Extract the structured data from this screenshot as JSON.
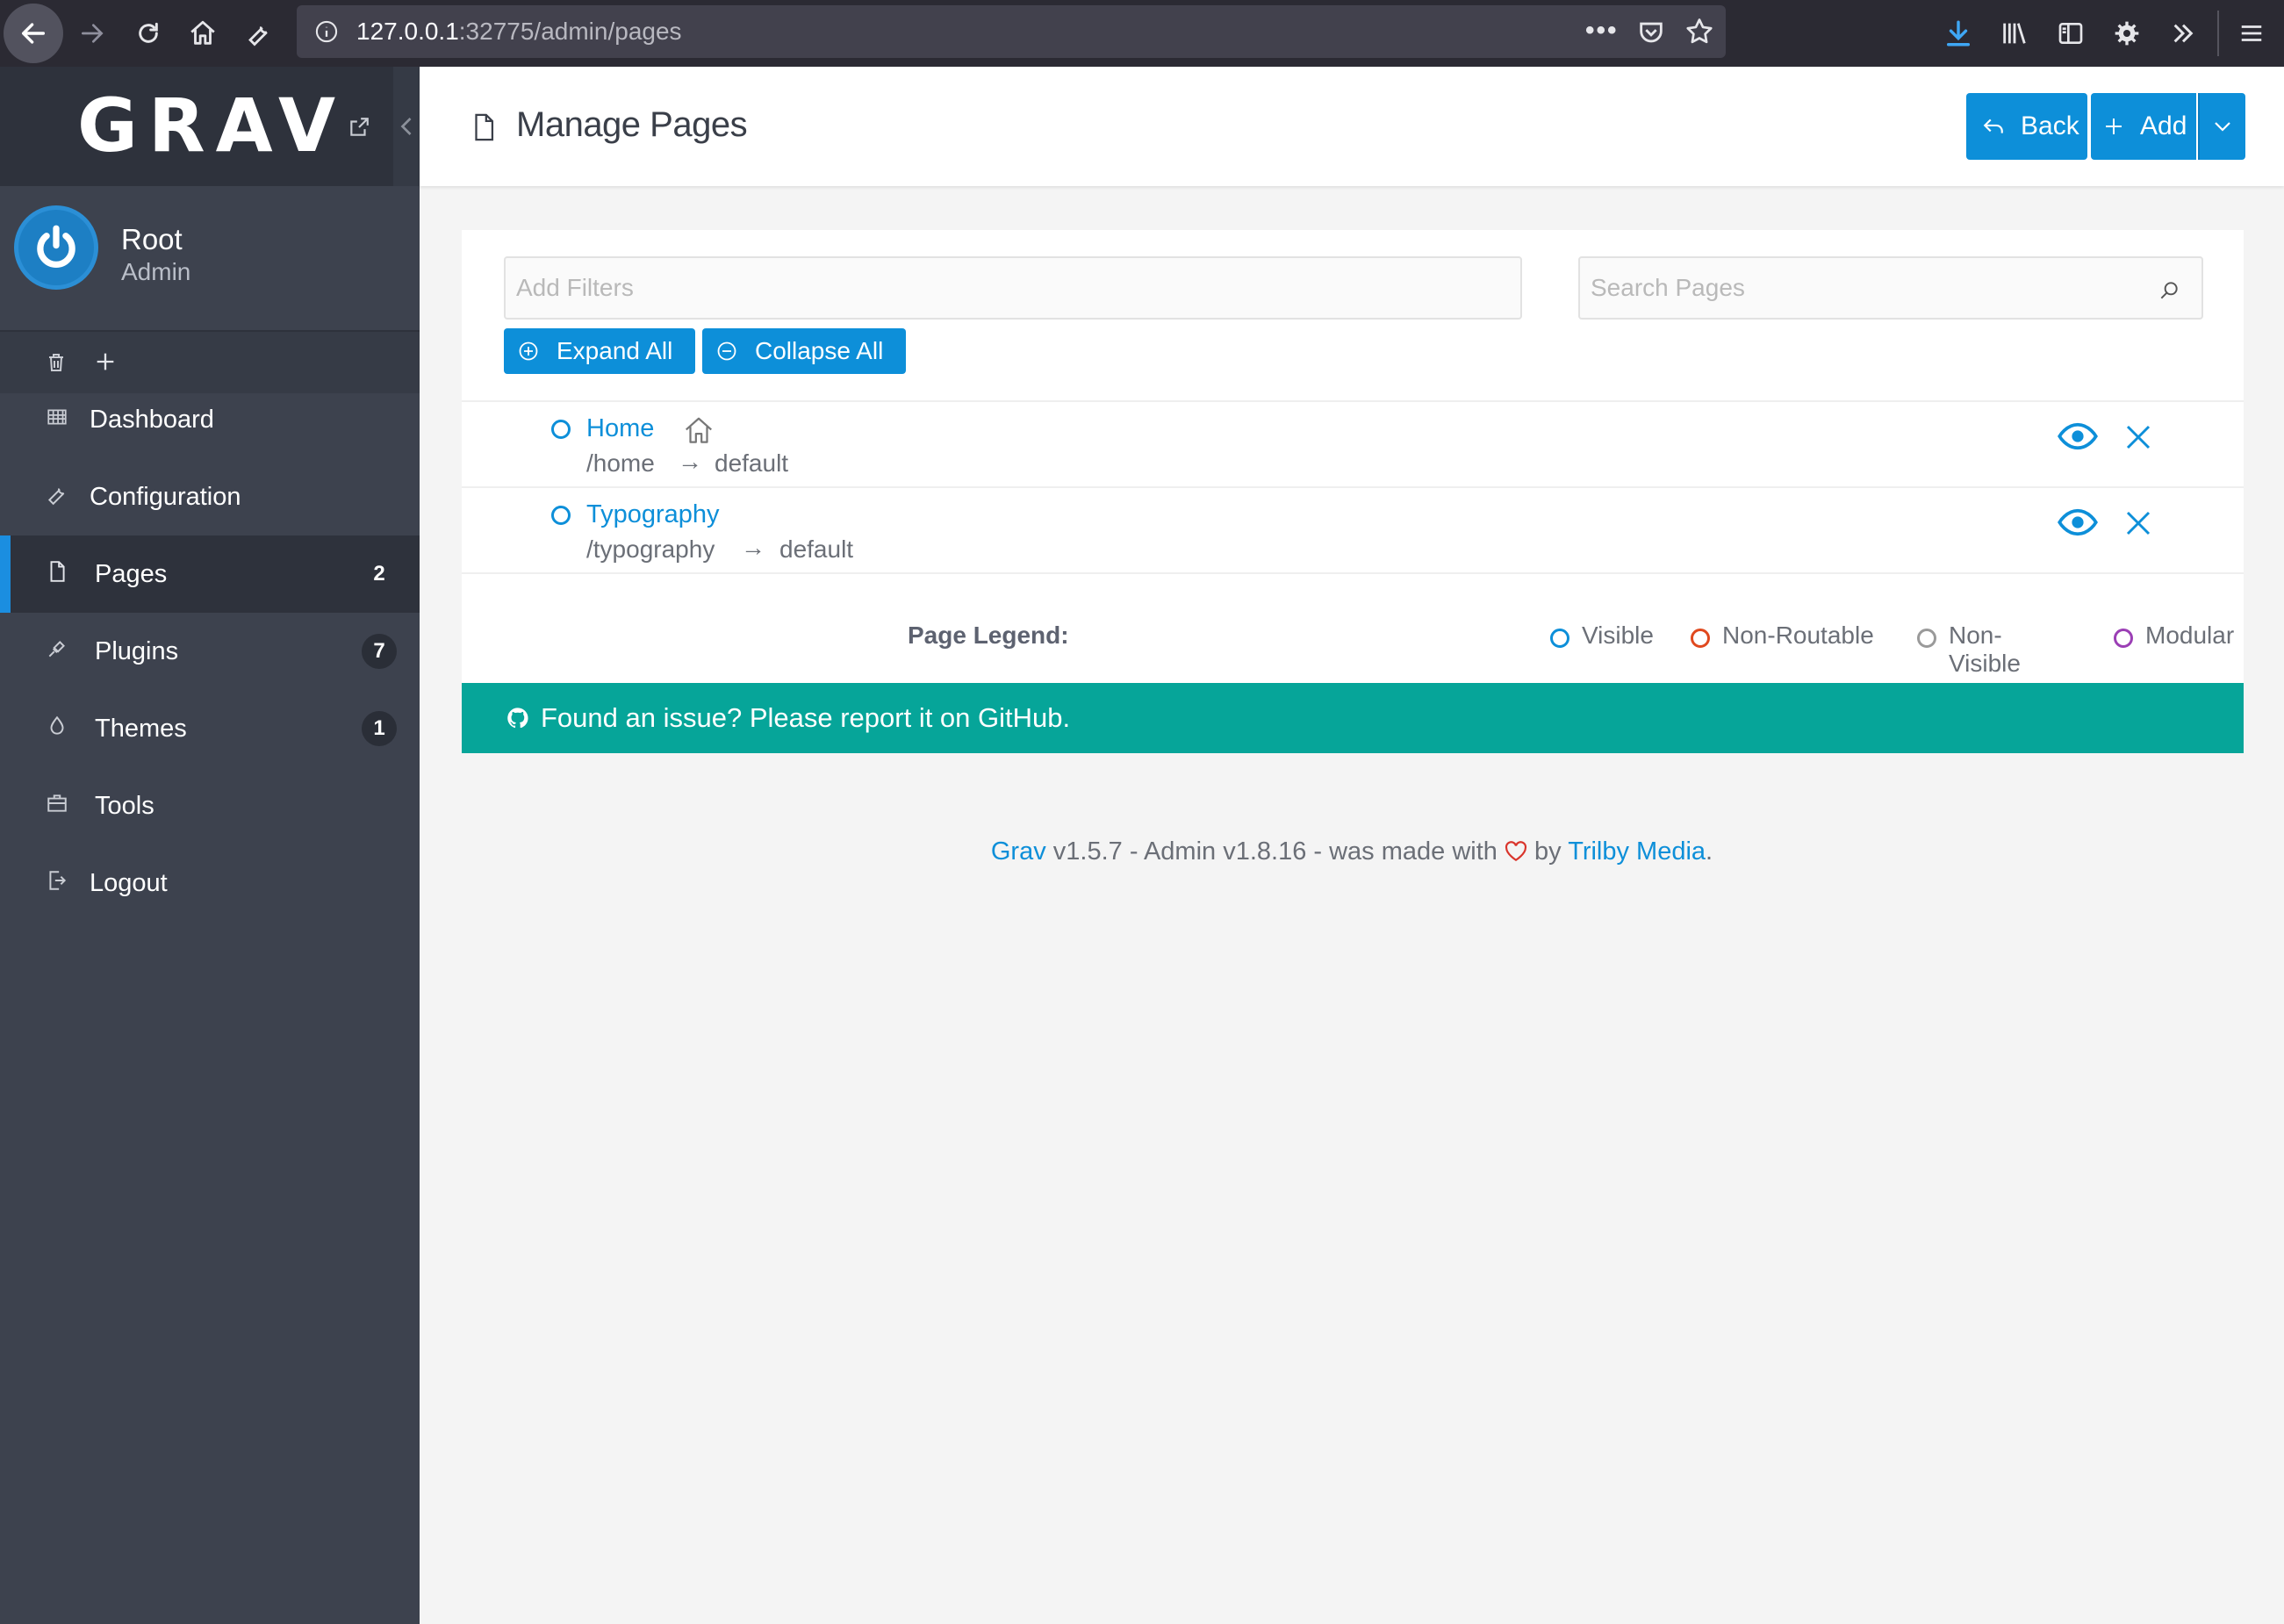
{
  "browser": {
    "url_host": "127.0.0.1",
    "url_rest": ":32775/admin/pages"
  },
  "sidebar": {
    "logo": "GRAV",
    "user": {
      "name": "Root",
      "role": "Admin"
    },
    "items": [
      {
        "label": "Dashboard",
        "icon": "dashboard-icon"
      },
      {
        "label": "Configuration",
        "icon": "wrench-icon"
      },
      {
        "label": "Pages",
        "icon": "file-icon",
        "badge": "2",
        "active": true
      },
      {
        "label": "Plugins",
        "icon": "plug-icon",
        "badge": "7"
      },
      {
        "label": "Themes",
        "icon": "droplet-icon",
        "badge": "1"
      },
      {
        "label": "Tools",
        "icon": "briefcase-icon"
      },
      {
        "label": "Logout",
        "icon": "logout-icon"
      }
    ]
  },
  "header": {
    "title": "Manage Pages",
    "back_label": "Back",
    "add_label": "Add"
  },
  "filters": {
    "filter_placeholder": "Add Filters",
    "search_placeholder": "Search Pages",
    "expand_label": "Expand All",
    "collapse_label": "Collapse All"
  },
  "pages": [
    {
      "title": "Home",
      "route": "/home",
      "template": "default",
      "is_home": true
    },
    {
      "title": "Typography",
      "route": "/typography",
      "template": "default"
    }
  ],
  "legend": {
    "title": "Page Legend:",
    "items": [
      {
        "label": "Visible",
        "color": "#0d8fd9"
      },
      {
        "label": "Non-Routable",
        "color": "#e0491f"
      },
      {
        "label": "Non-Visible",
        "color": "#9a9a9a"
      },
      {
        "label": "Modular",
        "color": "#9b3fb5"
      }
    ]
  },
  "banner": {
    "text": "Found an issue? Please report it on GitHub."
  },
  "footer": {
    "grav": "Grav",
    "versions": " v1.5.7 - Admin v1.8.16 - was made with ",
    "by": " by ",
    "trilby": "Trilby Media",
    "end": "."
  },
  "colors": {
    "accent": "#0d8fd9",
    "sidebar": "#3d424e",
    "banner": "#06a599"
  }
}
